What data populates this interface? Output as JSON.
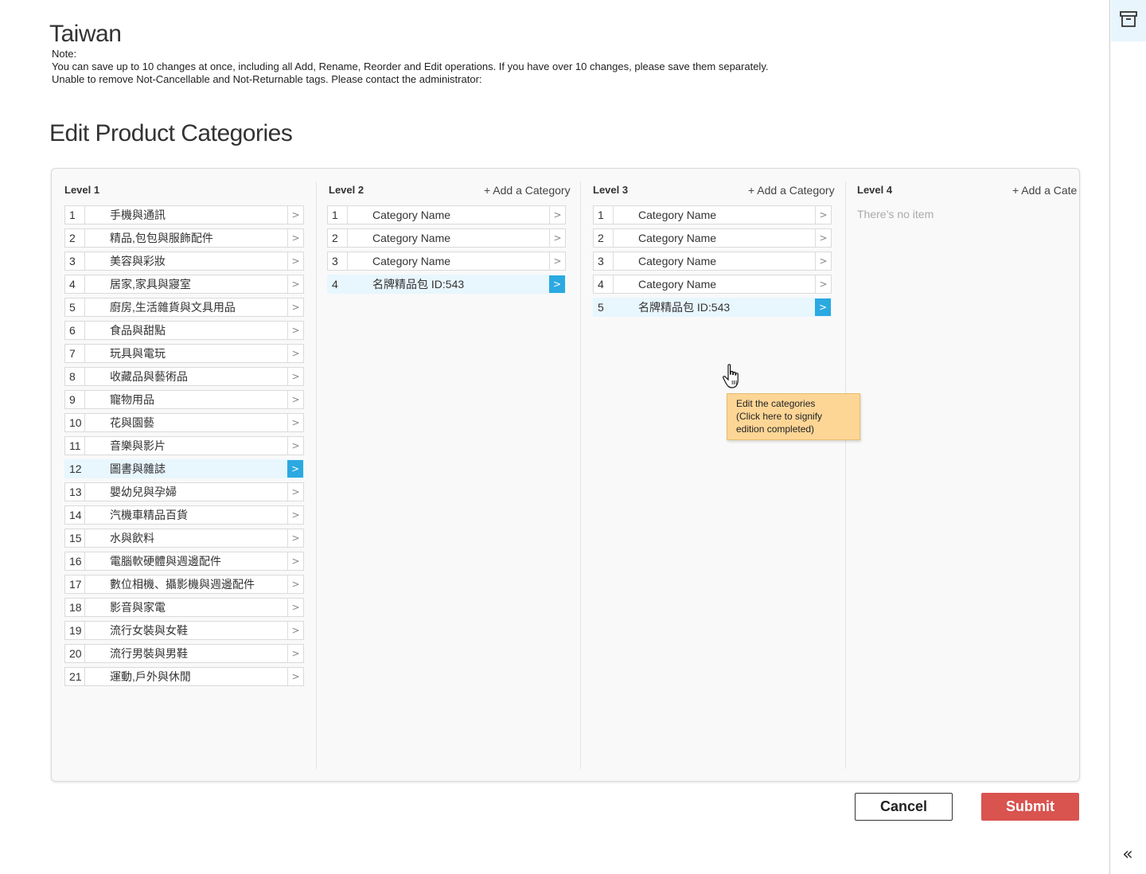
{
  "header": {
    "country": "Taiwan",
    "notes": [
      "Note:",
      "You can save up to 10 changes at once, including all Add, Rename, Reorder and Edit operations. If you have over 10 changes, please save them separately.",
      "Unable to remove Not-Cancellable and Not-Returnable tags. Please contact the administrator:"
    ]
  },
  "page_title": "Edit Product Categories",
  "columns": [
    {
      "title": "Level 1",
      "add_label": "",
      "items": [
        {
          "num": "1",
          "name": "手機與通訊",
          "selected": false
        },
        {
          "num": "2",
          "name": "精品,包包與服飾配件",
          "selected": false
        },
        {
          "num": "3",
          "name": "美容與彩妝",
          "selected": false
        },
        {
          "num": "4",
          "name": "居家,家具與寢室",
          "selected": false
        },
        {
          "num": "5",
          "name": "廚房,生活雜貨與文具用品",
          "selected": false
        },
        {
          "num": "6",
          "name": "食品與甜點",
          "selected": false
        },
        {
          "num": "7",
          "name": "玩具與電玩",
          "selected": false
        },
        {
          "num": "8",
          "name": "收藏品與藝術品",
          "selected": false
        },
        {
          "num": "9",
          "name": "寵物用品",
          "selected": false
        },
        {
          "num": "10",
          "name": "花與園藝",
          "selected": false
        },
        {
          "num": "11",
          "name": "音樂與影片",
          "selected": false
        },
        {
          "num": "12",
          "name": "圖書與雜誌",
          "selected": true
        },
        {
          "num": "13",
          "name": "嬰幼兒與孕婦",
          "selected": false
        },
        {
          "num": "14",
          "name": "汽機車精品百貨",
          "selected": false
        },
        {
          "num": "15",
          "name": "水與飲料",
          "selected": false
        },
        {
          "num": "16",
          "name": "電腦軟硬體與週邊配件",
          "selected": false
        },
        {
          "num": "17",
          "name": "數位相機、攝影機與週邊配件",
          "selected": false
        },
        {
          "num": "18",
          "name": "影音與家電",
          "selected": false
        },
        {
          "num": "19",
          "name": "流行女裝與女鞋",
          "selected": false
        },
        {
          "num": "20",
          "name": "流行男裝與男鞋",
          "selected": false
        },
        {
          "num": "21",
          "name": "運動,戶外與休閒",
          "selected": false
        }
      ]
    },
    {
      "title": "Level 2",
      "add_label": "+ Add a Category",
      "items": [
        {
          "num": "1",
          "name": "Category Name",
          "selected": false
        },
        {
          "num": "2",
          "name": "Category Name",
          "selected": false
        },
        {
          "num": "3",
          "name": "Category Name",
          "selected": false
        },
        {
          "num": "4",
          "name": "名牌精品包 ID:543",
          "selected": true
        }
      ]
    },
    {
      "title": "Level 3",
      "add_label": "+ Add a Category",
      "items": [
        {
          "num": "1",
          "name": "Category Name",
          "selected": false
        },
        {
          "num": "2",
          "name": "Category Name",
          "selected": false
        },
        {
          "num": "3",
          "name": "Category Name",
          "selected": false
        },
        {
          "num": "4",
          "name": "Category Name",
          "selected": false
        },
        {
          "num": "5",
          "name": "名牌精品包 ID:543",
          "selected": true
        }
      ]
    },
    {
      "title": "Level 4",
      "add_label": "+ Add a Cate",
      "empty_text": "There’s no item",
      "items": []
    }
  ],
  "tooltip": {
    "lines": [
      "Edit the categories",
      "(Click here to signify",
      "edition completed)"
    ]
  },
  "buttons": {
    "cancel": "Cancel",
    "submit": "Submit"
  },
  "icons": {
    "arrow": "chevron-right-icon",
    "archive": "archive-box-icon",
    "collapse": "double-chevron-left-icon",
    "cursor": "hand-pointer-icon"
  },
  "colors": {
    "accent": "#2ba9e1",
    "selected_row": "#e8f6fd",
    "submit": "#d9534f",
    "tooltip": "#fdd696"
  }
}
